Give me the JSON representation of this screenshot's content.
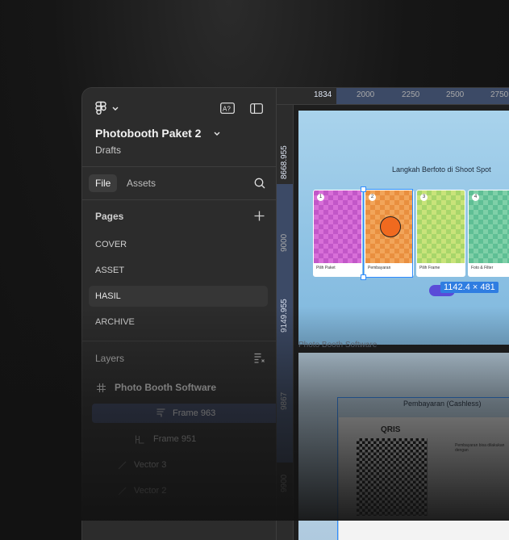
{
  "app": {
    "logo": "figma-logo",
    "file_title": "Photobooth Paket 2",
    "file_location": "Drafts"
  },
  "tabs": [
    {
      "label": "File",
      "active": true
    },
    {
      "label": "Assets",
      "active": false
    }
  ],
  "pages": {
    "title": "Pages",
    "items": [
      {
        "label": "COVER",
        "selected": false
      },
      {
        "label": "ASSET",
        "selected": false
      },
      {
        "label": "HASIL",
        "selected": true
      },
      {
        "label": "ARCHIVE",
        "selected": false
      }
    ]
  },
  "layers": {
    "title": "Layers",
    "items": [
      {
        "label": "Photo Booth Software",
        "icon": "frame-hash-icon"
      },
      {
        "label": "Frame 963",
        "icon": "frame-layout-icon",
        "selected": true
      },
      {
        "label": "Frame 951",
        "icon": "frame-layout-icon"
      },
      {
        "label": "Vector 3",
        "icon": "vector-icon"
      },
      {
        "label": "Vector 2",
        "icon": "vector-icon"
      }
    ]
  },
  "rulers": {
    "top": [
      "1834",
      "2000",
      "2250",
      "2500",
      "2750"
    ],
    "left": [
      "8668.955",
      "9000",
      "9149.955",
      "9867",
      "9900"
    ]
  },
  "canvas": {
    "frame_a_label": "Photo Booth Software",
    "heading": "Langkah Berfoto di Shoot Spot",
    "cards": [
      {
        "num": "1",
        "caption": "Pilih Paket"
      },
      {
        "num": "2",
        "caption": "Pembayaran"
      },
      {
        "num": "3",
        "caption": "Pilih Frame"
      },
      {
        "num": "4",
        "caption": "Foto & Filter"
      }
    ],
    "selection_size": "1142.4 × 481",
    "frame_b_heading": "Pembayaran (Cashless)",
    "frame_b_brand": "QRIS",
    "frame_b_text": "Pembayaran bisa dilakukan dengan"
  },
  "colors": {
    "panel_bg": "#2c2c2c",
    "selection_blue": "#2f8cff",
    "ruler_highlight": "#3c4a66"
  }
}
